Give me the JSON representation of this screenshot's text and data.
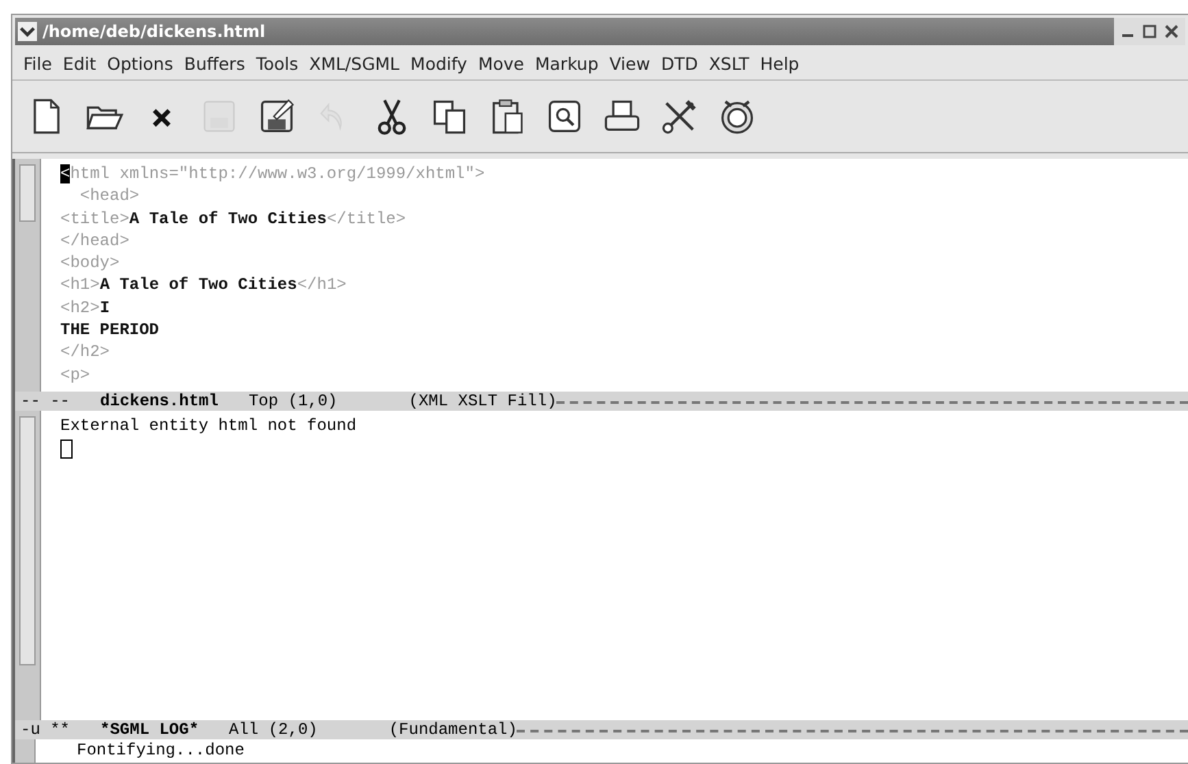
{
  "window": {
    "title": "/home/deb/dickens.html"
  },
  "menu": [
    "File",
    "Edit",
    "Options",
    "Buffers",
    "Tools",
    "XML/SGML",
    "Modify",
    "Move",
    "Markup",
    "View",
    "DTD",
    "XSLT",
    "Help"
  ],
  "toolbar": [
    {
      "kind": "new",
      "disabled": false
    },
    {
      "kind": "open",
      "disabled": false
    },
    {
      "kind": "close",
      "disabled": false
    },
    {
      "kind": "save",
      "disabled": true
    },
    {
      "kind": "saveas",
      "disabled": false
    },
    {
      "kind": "undo",
      "disabled": true
    },
    {
      "kind": "cut",
      "disabled": false
    },
    {
      "kind": "copy",
      "disabled": false
    },
    {
      "kind": "paste",
      "disabled": false
    },
    {
      "kind": "find",
      "disabled": false
    },
    {
      "kind": "print",
      "disabled": false
    },
    {
      "kind": "tools",
      "disabled": false
    },
    {
      "kind": "spell",
      "disabled": false
    }
  ],
  "editor": {
    "lines": [
      [
        {
          "text": "<",
          "kind": "cursor"
        },
        {
          "text": "html xmlns=\"http://www.w3.org/1999/xhtml\">",
          "kind": "tag"
        }
      ],
      [
        {
          "text": "  <head>",
          "kind": "tag"
        }
      ],
      [
        {
          "text": "<title>",
          "kind": "tag"
        },
        {
          "text": "A Tale of Two Cities",
          "kind": "text"
        },
        {
          "text": "</title>",
          "kind": "tag"
        }
      ],
      [
        {
          "text": "</head>",
          "kind": "tag"
        }
      ],
      [
        {
          "text": "<body>",
          "kind": "tag"
        }
      ],
      [
        {
          "text": "<h1>",
          "kind": "tag"
        },
        {
          "text": "A Tale of Two Cities",
          "kind": "text"
        },
        {
          "text": "</h1>",
          "kind": "tag"
        }
      ],
      [
        {
          "text": "<h2>",
          "kind": "tag"
        },
        {
          "text": "I",
          "kind": "text"
        }
      ],
      [
        {
          "text": "THE PERIOD",
          "kind": "text"
        }
      ],
      [
        {
          "text": "</h2>",
          "kind": "tag"
        }
      ],
      [
        {
          "text": "<p>",
          "kind": "tag"
        }
      ]
    ],
    "modeline": {
      "flags": "-- --",
      "buffer": "dickens.html",
      "position": "Top (1,0)",
      "modes": "(XML XSLT Fill)"
    }
  },
  "log": {
    "lines": [
      "External entity html not found"
    ],
    "cursor": true,
    "modeline": {
      "flags": "-u **",
      "buffer": "*SGML LOG*",
      "position": "All (2,0)",
      "modes": "(Fundamental)"
    }
  },
  "echo_area": "Fontifying...done"
}
